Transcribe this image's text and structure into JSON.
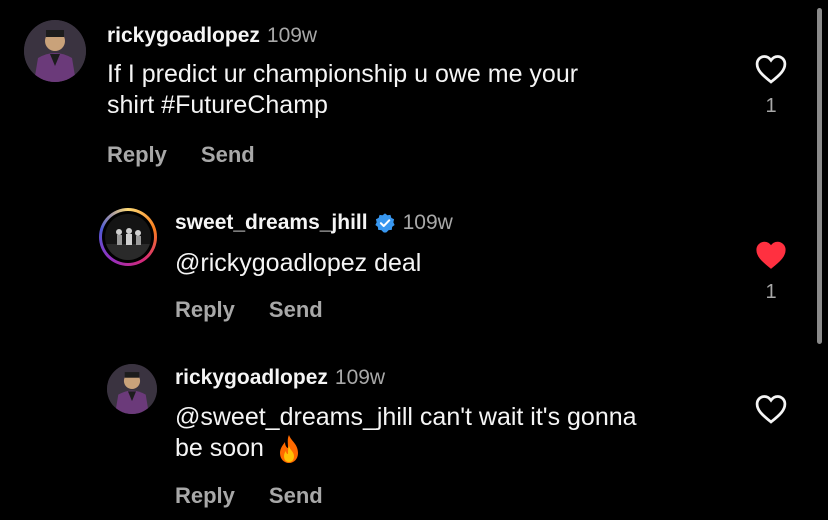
{
  "comments": [
    {
      "username": "rickygoadlopez",
      "timestamp": "109w",
      "text_lines": [
        "If I predict ur championship u owe me your",
        "shirt #FutureChamp"
      ],
      "reply_label": "Reply",
      "send_label": "Send",
      "like_count": "1",
      "liked": false
    },
    {
      "username": "sweet_dreams_jhill",
      "verified": true,
      "timestamp": "109w",
      "text_lines": [
        "@rickygoadlopez deal"
      ],
      "reply_label": "Reply",
      "send_label": "Send",
      "like_count": "1",
      "liked": true
    },
    {
      "username": "rickygoadlopez",
      "timestamp": "109w",
      "text_lines": [
        "@sweet_dreams_jhill can't wait it's gonna",
        "be soon"
      ],
      "emoji": "fire-emoji",
      "reply_label": "Reply",
      "send_label": "Send",
      "liked": false
    }
  ],
  "colors": {
    "background": "#000000",
    "text": "#f5f5f5",
    "secondary": "#a8a8a8",
    "liked_heart": "#ff3040",
    "verified_badge": "#3897f0"
  }
}
